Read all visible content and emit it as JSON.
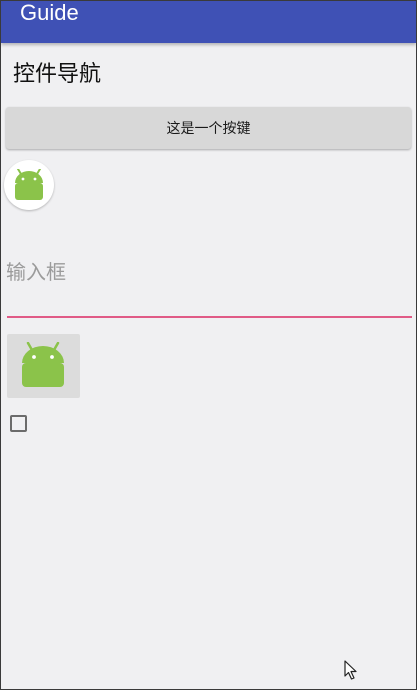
{
  "app": {
    "title": "Guide"
  },
  "main": {
    "heading": "控件导航",
    "button_label": "这是一个按键",
    "input": {
      "placeholder": "输入框",
      "value": ""
    },
    "checkbox_checked": false
  },
  "icons": {
    "avatar": "android-icon",
    "image_button": "android-icon",
    "cursor": "mouse-pointer-icon"
  },
  "colors": {
    "app_bar": "#3f51b5",
    "background": "#f0f0f2",
    "input_underline": "#e05a86",
    "android_green": "#8bc34a"
  }
}
